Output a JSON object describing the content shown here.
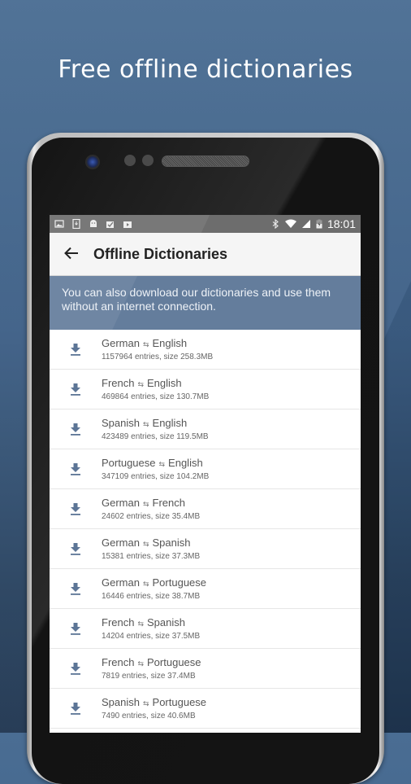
{
  "headline": "Free offline dictionaries",
  "status_bar": {
    "left_icons": [
      "image-icon",
      "download-icon",
      "android-icon",
      "clipboard-check-icon",
      "play-store-icon"
    ],
    "right_icons": [
      "bluetooth-icon",
      "wifi-icon",
      "cell-signal-icon",
      "battery-charging-icon"
    ],
    "time": "18:01"
  },
  "toolbar": {
    "back_icon": "arrow-left-icon",
    "title": "Offline Dictionaries"
  },
  "banner": {
    "text": "You can also download our dictionaries and use them without an internet connection."
  },
  "colors": {
    "accent": "#647d9c",
    "download_icon": "#5c7596",
    "background": "#3d5f86"
  },
  "dictionaries": [
    {
      "from": "German",
      "to": "English",
      "details": "1157964 entries, size 258.3MB"
    },
    {
      "from": "French",
      "to": "English",
      "details": "469864 entries, size 130.7MB"
    },
    {
      "from": "Spanish",
      "to": "English",
      "details": "423489 entries, size 119.5MB"
    },
    {
      "from": "Portuguese",
      "to": "English",
      "details": "347109 entries, size 104.2MB"
    },
    {
      "from": "German",
      "to": "French",
      "details": "24602 entries, size 35.4MB"
    },
    {
      "from": "German",
      "to": "Spanish",
      "details": "15381 entries, size 37.3MB"
    },
    {
      "from": "German",
      "to": "Portuguese",
      "details": "16446 entries, size 38.7MB"
    },
    {
      "from": "French",
      "to": "Spanish",
      "details": "14204 entries, size 37.5MB"
    },
    {
      "from": "French",
      "to": "Portuguese",
      "details": "7819 entries, size 37.4MB"
    },
    {
      "from": "Spanish",
      "to": "Portuguese",
      "details": "7490 entries, size 40.6MB"
    }
  ],
  "swap_glyph": "⇆"
}
